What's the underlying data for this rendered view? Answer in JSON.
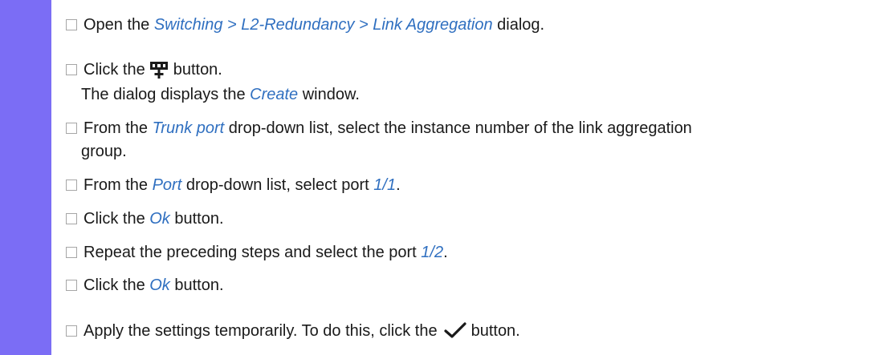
{
  "steps": [
    {
      "a": "Open the ",
      "hl": "Switching > L2-Redundancy > Link Aggregation",
      "b": " dialog."
    },
    {
      "a": "Click the",
      "b": "button."
    },
    {
      "result": "The dialog displays the ",
      "hl": "Create",
      "b": " window."
    },
    {
      "a": "From the ",
      "hl": "Trunk port",
      "b": " drop-down list, select the instance number of the link aggregation",
      "cont": "group."
    },
    {
      "a": "From the ",
      "hl": "Port",
      "b": " drop-down list, select port ",
      "hl2": "1/1",
      "c": "."
    },
    {
      "a": "Click the ",
      "hl": "Ok",
      "b": " button."
    },
    {
      "a": "Repeat the preceding steps and select the port ",
      "hl": "1/2",
      "b": "."
    },
    {
      "a": "Click the ",
      "hl": "Ok",
      "b": " button."
    },
    {
      "a": "Apply the settings temporarily. To do this, click the",
      "b": "button."
    }
  ],
  "icons": {
    "create": "add-table-icon",
    "apply": "checkmark-icon"
  },
  "colors": {
    "sidebar": "#7b6df5",
    "highlight": "#2f6fc0"
  }
}
